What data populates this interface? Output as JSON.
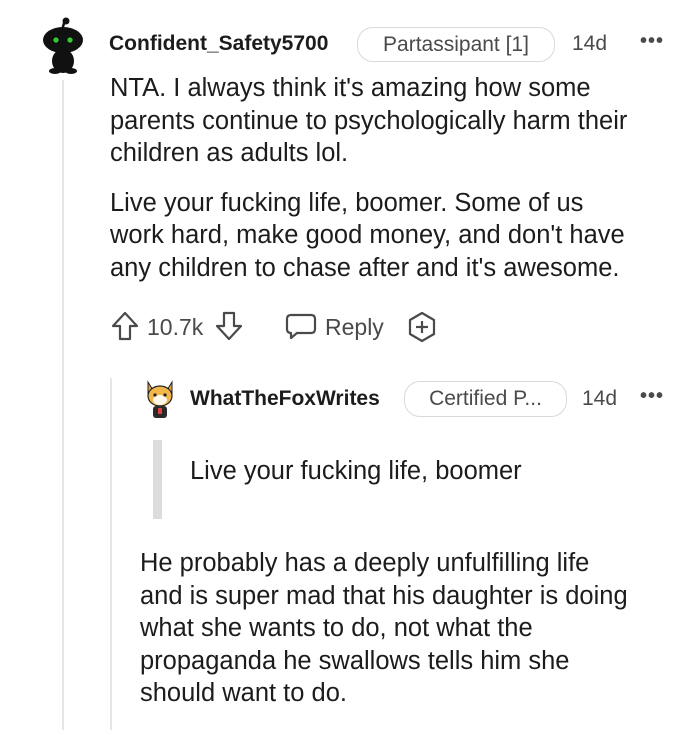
{
  "comment": {
    "username": "Confident_Safety5700",
    "flair": "Partassipant [1]",
    "age": "14d",
    "more": "•••",
    "paragraphs": [
      [
        "NTA. I always think it's amazing how some",
        "parents continue to psychologically harm their",
        "children as adults lol."
      ],
      [
        "Live your fucking life, boomer. Some of us",
        "work hard, make good money, and don't have",
        "any children to chase after and it's awesome."
      ]
    ],
    "vote_count": "10.7k",
    "reply_label": "Reply",
    "avatar_icon": "snoo-avatar-icon",
    "upvote_icon": "upvote-arrow-icon",
    "downvote_icon": "downvote-arrow-icon",
    "reply_icon": "chat-bubble-icon",
    "award_icon": "award-plus-icon"
  },
  "reply": {
    "username": "WhatTheFoxWrites",
    "flair": "Certified P...",
    "age": "14d",
    "more": "•••",
    "quote": "Live your fucking life, boomer",
    "body_lines": [
      "He probably has a deeply unfulfilling life",
      "and is super mad that his daughter is doing",
      "what she wants to do, not what the",
      "propaganda he swallows tells him she",
      "should want to do."
    ],
    "avatar_icon": "fox-avatar-icon"
  },
  "colors": {
    "text": "#1c1c1c",
    "muted": "#4a4a4a",
    "border": "#d9d9d9",
    "snoo_eyes": "#32cd32"
  }
}
